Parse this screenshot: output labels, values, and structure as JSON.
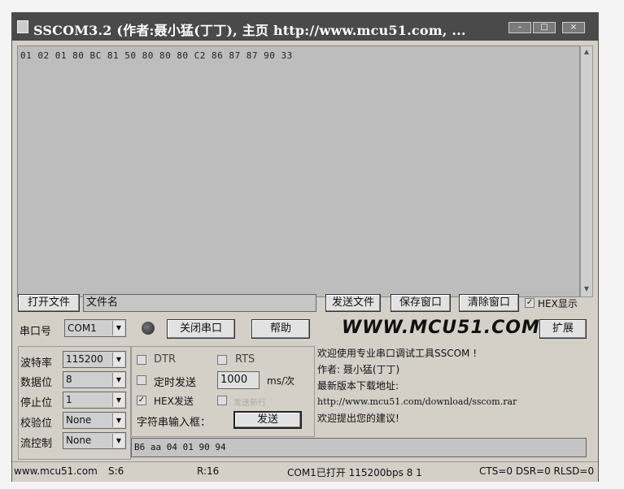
{
  "window": {
    "title": "SSCOM3.2 (作者:聂小猛(丁丁), 主页 http://www.mcu51.com, ..."
  },
  "titlebar_buttons": {
    "minimize": "–",
    "maximize": "□",
    "close": "×"
  },
  "receive": {
    "text": "01 02 01 80 BC 81 50 80 80 80 C2 86 87 87 90 33"
  },
  "file_row": {
    "open_file_label": "打开文件",
    "filename_value": "文件名",
    "send_file_label": "发送文件",
    "save_window_label": "保存窗口",
    "clear_window_label": "清除窗口",
    "hex_display_label": "HEX显示",
    "hex_display_checked": true
  },
  "port_row": {
    "port_label": "串口号",
    "port_value": "COM1",
    "close_port_label": "关闭串口",
    "help_label": "帮助",
    "site_banner": "WWW.MCU51.COM",
    "expand_label": "扩展"
  },
  "settings": {
    "baud_label": "波特率",
    "baud_value": "115200",
    "databits_label": "数据位",
    "databits_value": "8",
    "stopbits_label": "停止位",
    "stopbits_value": "1",
    "parity_label": "校验位",
    "parity_value": "None",
    "flow_label": "流控制",
    "flow_value": "None"
  },
  "options": {
    "dtr_label": "DTR",
    "rts_label": "RTS",
    "timed_send_label": "定时发送",
    "interval_value": "1000",
    "interval_unit": "ms/次",
    "hex_send_label": "HEX发送",
    "hex_send_checked": true,
    "send_newline_label": "发送新行",
    "string_input_label": "字符串输入框：",
    "send_label": "发送"
  },
  "info": {
    "line1": "欢迎使用专业串口调试工具SSCOM !",
    "line2": "作者: 聂小猛(丁丁)",
    "line3": "最新版本下载地址:",
    "line4": "http://www.mcu51.com/download/sscom.rar",
    "line5": "欢迎提出您的建议!"
  },
  "send_input": {
    "value": "B6 aa 04 01 90 94"
  },
  "status": {
    "site": "www.mcu51.com",
    "sent": "S:6",
    "received": "R:16",
    "port_state": "COM1已打开  115200bps 8 1",
    "signals": "CTS=0 DSR=0 RLSD=0"
  }
}
